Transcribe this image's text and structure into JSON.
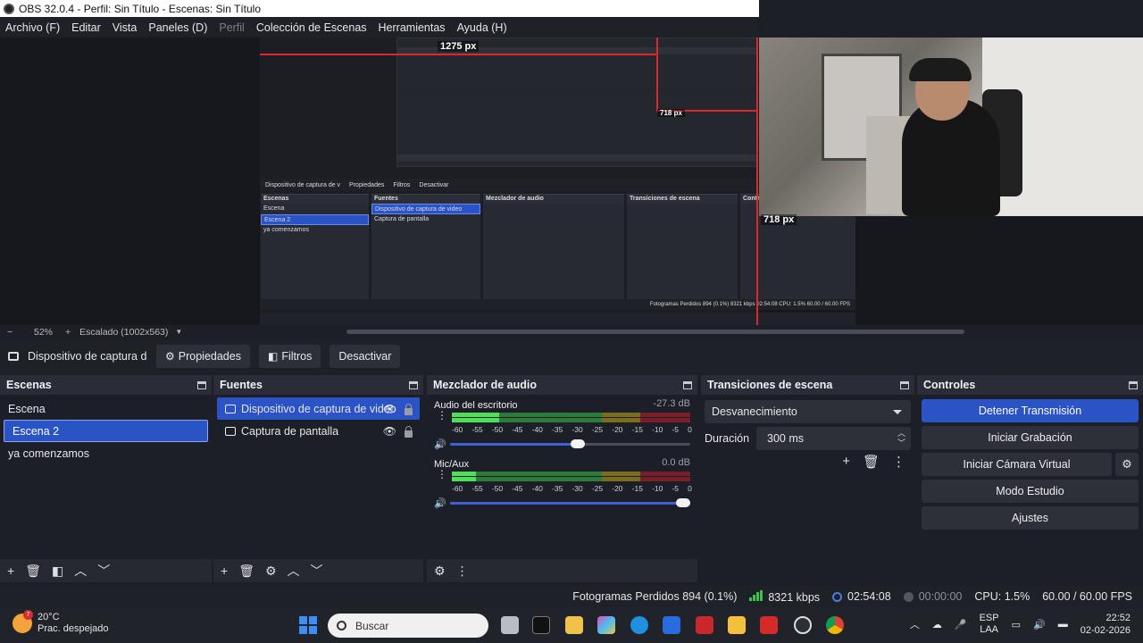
{
  "window": {
    "title": "OBS 32.0.4 - Perfil: Sin Título - Escenas: Sin Título"
  },
  "menu": [
    {
      "label": "Archivo (F)",
      "disabled": false
    },
    {
      "label": "Editar",
      "disabled": false
    },
    {
      "label": "Vista",
      "disabled": false
    },
    {
      "label": "Paneles (D)",
      "disabled": false
    },
    {
      "label": "Perfil",
      "disabled": true
    },
    {
      "label": "Colección de Escenas",
      "disabled": false
    },
    {
      "label": "Herramientas",
      "disabled": false
    },
    {
      "label": "Ayuda (H)",
      "disabled": false
    }
  ],
  "preview": {
    "width_label": "1275 px",
    "height_label": "718 px",
    "height_label_small": "718 px",
    "nested": {
      "toolbar_zoom": "52%",
      "toolbar_scale": "Escalado (1002x563)",
      "source_name": "Dispositivo de captura de v",
      "props": "Propiedades",
      "filters": "Filtros",
      "deactivate": "Desactivar",
      "scenes_title": "Escenas",
      "scenes": [
        "Escena",
        "Escena 2",
        "ya comenzamos"
      ],
      "sources_title": "Fuentes",
      "sources": [
        "Dispositivo de captura de video",
        "Captura de pantalla"
      ],
      "mixer_title": "Mezclador de audio",
      "trans_title": "Transiciones de escena",
      "controls_title": "Contr",
      "status": "Fotogramas Perdidos 894 (0.1%)   8321 kbps   02:54:08   CPU: 1.5%   60.00 / 60.00 FPS"
    }
  },
  "zoom": {
    "minus": "−",
    "value": "52%",
    "plus": "+",
    "scale": "Escalado (1002x563)"
  },
  "source_toolbar": {
    "source_name": "Dispositivo de captura de v",
    "properties": "Propiedades",
    "filters": "Filtros",
    "deactivate": "Desactivar"
  },
  "scenes": {
    "title": "Escenas",
    "items": [
      "Escena",
      "Escena 2",
      "ya comenzamos"
    ],
    "selected_index": 1
  },
  "sources": {
    "title": "Fuentes",
    "items": [
      {
        "label": "Dispositivo de captura de video",
        "icon": "camera-icon"
      },
      {
        "label": "Captura de pantalla",
        "icon": "monitor-icon"
      }
    ],
    "selected_index": 0
  },
  "mixer": {
    "title": "Mezclador de audio",
    "channels": [
      {
        "name": "Audio del escritorio",
        "db": "-27.3 dB",
        "level": 0.2,
        "volume": 0.56
      },
      {
        "name": "Mic/Aux",
        "db": "0.0 dB",
        "level": 0.1,
        "volume": 1.0
      }
    ],
    "scale": [
      "-60",
      "-55",
      "-50",
      "-45",
      "-40",
      "-35",
      "-30",
      "-25",
      "-20",
      "-15",
      "-10",
      "-5",
      "0"
    ]
  },
  "transitions": {
    "title": "Transiciones de escena",
    "selected": "Desvanecimiento",
    "duration_label": "Duración",
    "duration_value": "300 ms"
  },
  "controls": {
    "title": "Controles",
    "stop_stream": "Detener Transmisión",
    "start_recording": "Iniciar Grabación",
    "start_virtual_cam": "Iniciar Cámara Virtual",
    "studio_mode": "Modo Estudio",
    "settings": "Ajustes"
  },
  "status": {
    "dropped_frames": "Fotogramas Perdidos 894 (0.1%)",
    "bitrate": "8321 kbps",
    "stream_time": "02:54:08",
    "record_time": "00:00:00",
    "cpu": "CPU: 1.5%",
    "fps": "60.00 / 60.00 FPS"
  },
  "taskbar": {
    "temperature": "20°C",
    "weather": "Prac. despejado",
    "weather_badge": "7",
    "search_placeholder": "Buscar",
    "lang_top": "ESP",
    "lang_bottom": "LAA",
    "time": "22:52",
    "date": "02-02-2026"
  },
  "colors": {
    "accent": "#2a53c6",
    "panel": "#262932",
    "panel_body": "#1c1f27",
    "meter_green": "#4fe05a",
    "red_guide": "#e0262c"
  }
}
